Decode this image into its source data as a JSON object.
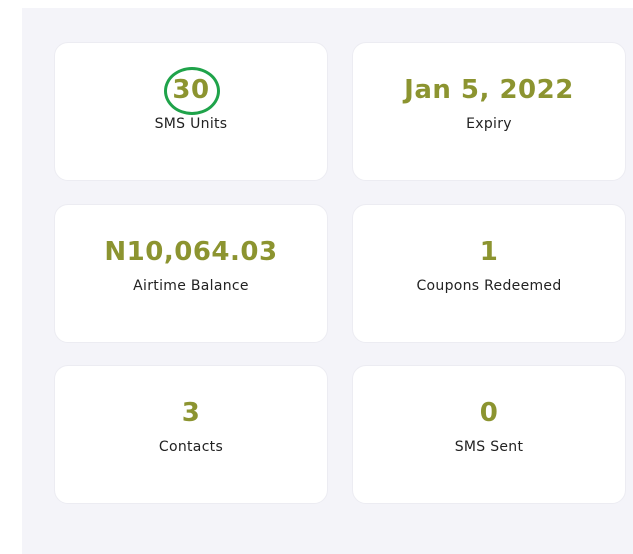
{
  "stats": [
    {
      "value": "30",
      "label": "SMS Units"
    },
    {
      "value": "Jan 5, 2022",
      "label": "Expiry"
    },
    {
      "value": "N10,064.03",
      "label": "Airtime Balance"
    },
    {
      "value": "1",
      "label": "Coupons Redeemed"
    },
    {
      "value": "3",
      "label": "Contacts"
    },
    {
      "value": "0",
      "label": "SMS Sent"
    }
  ],
  "colors": {
    "value_text": "#8c9430",
    "highlight_ring": "#1fa34a",
    "panel_bg": "#f4f4f9",
    "card_bg": "#ffffff"
  }
}
